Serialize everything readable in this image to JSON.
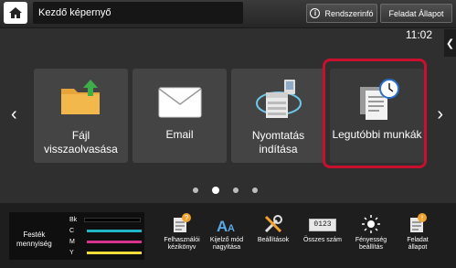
{
  "header": {
    "title": "Kezdő képernyő",
    "info_button": "Rendszerinfó",
    "job_status_button": "Feladat Állapot",
    "clock": "11:02"
  },
  "tiles": [
    {
      "label_line1": "Fájl",
      "label_line2": "visszaolvasása"
    },
    {
      "label_line1": "Email",
      "label_line2": ""
    },
    {
      "label_line1": "Nyomtatás",
      "label_line2": "indítása"
    },
    {
      "label_line1": "Legutóbbi munkák",
      "label_line2": ""
    }
  ],
  "pagination": {
    "total": 4,
    "active": 2
  },
  "toner": {
    "title_line1": "Festék",
    "title_line2": "mennyiség",
    "colors": [
      {
        "label": "Bk",
        "color": "#000000"
      },
      {
        "label": "C",
        "color": "#1fb5c7"
      },
      {
        "label": "M",
        "color": "#d6338f"
      },
      {
        "label": "Y",
        "color": "#f1dc3a"
      }
    ]
  },
  "quick_actions": [
    {
      "icon": "manual-book-icon",
      "line1": "Felhasználói",
      "line2": "kézikönyv"
    },
    {
      "icon": "display-mode-icon",
      "line1": "Kijelző mód",
      "line2": "nagyítása"
    },
    {
      "icon": "tools-icon",
      "line1": "Beállítások",
      "line2": ""
    },
    {
      "icon": "counter-icon",
      "line1": "Összes szám",
      "line2": ""
    },
    {
      "icon": "brightness-icon",
      "line1": "Fényesség",
      "line2": "beállítás"
    },
    {
      "icon": "job-status-icon",
      "line1": "Feladat",
      "line2": "állapot"
    }
  ],
  "counter_display": "0123"
}
